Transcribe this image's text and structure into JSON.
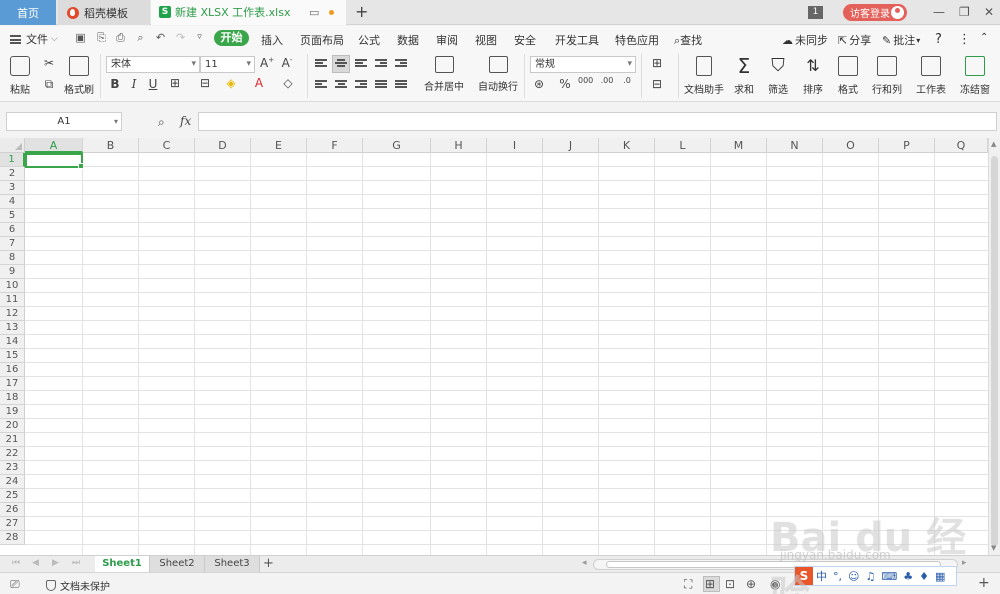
{
  "titlebar": {
    "tabs": [
      {
        "label": "首页",
        "active": false
      },
      {
        "label": "稻壳模板",
        "active": false
      },
      {
        "label": "新建 XLSX 工作表.xlsx",
        "active": true
      }
    ],
    "page_count": "1",
    "login_label": "访客登录"
  },
  "menu": {
    "file_label": "文件",
    "start_label": "开始",
    "items": [
      "插入",
      "页面布局",
      "公式",
      "数据",
      "审阅",
      "视图",
      "安全",
      "开发工具",
      "特色应用"
    ],
    "search_label": "查找",
    "sync_label": "未同步",
    "share_label": "分享",
    "comment_label": "批注"
  },
  "ribbon": {
    "paste_label": "粘贴",
    "format_painter_label": "格式刷",
    "font_name": "宋体",
    "font_size": "11",
    "merge_label": "合并居中",
    "wrap_label": "自动换行",
    "number_format": "常规",
    "doc_helper_label": "文档助手",
    "sum_label": "求和",
    "filter_label": "筛选",
    "sort_label": "排序",
    "format_label": "格式",
    "rowcol_label": "行和列",
    "sheet_label": "工作表",
    "freeze_label": "冻结窗"
  },
  "formula_bar": {
    "cell_ref": "A1",
    "fx_label": "fx",
    "value": ""
  },
  "grid": {
    "columns": [
      "A",
      "B",
      "C",
      "D",
      "E",
      "F",
      "G",
      "H",
      "I",
      "J",
      "K",
      "L",
      "M",
      "N",
      "O",
      "P",
      "Q"
    ],
    "rows": [
      "1",
      "2",
      "3",
      "4",
      "5",
      "6",
      "7",
      "8",
      "9",
      "10",
      "11",
      "12",
      "13",
      "14",
      "15",
      "16",
      "17",
      "18",
      "19",
      "20",
      "21",
      "22",
      "23",
      "24",
      "25",
      "26",
      "27",
      "28"
    ],
    "active_cell": "A1",
    "accent_color": "#3aa64a"
  },
  "sheets": {
    "tabs": [
      "Sheet1",
      "Sheet2",
      "Sheet3"
    ],
    "active": "Sheet1"
  },
  "status": {
    "protect_label": "文档未保护"
  },
  "ime": {
    "logo": "S",
    "mode": "中"
  },
  "watermark": {
    "text": "Bai du 经验",
    "url": "jingyan.baidu.com"
  }
}
